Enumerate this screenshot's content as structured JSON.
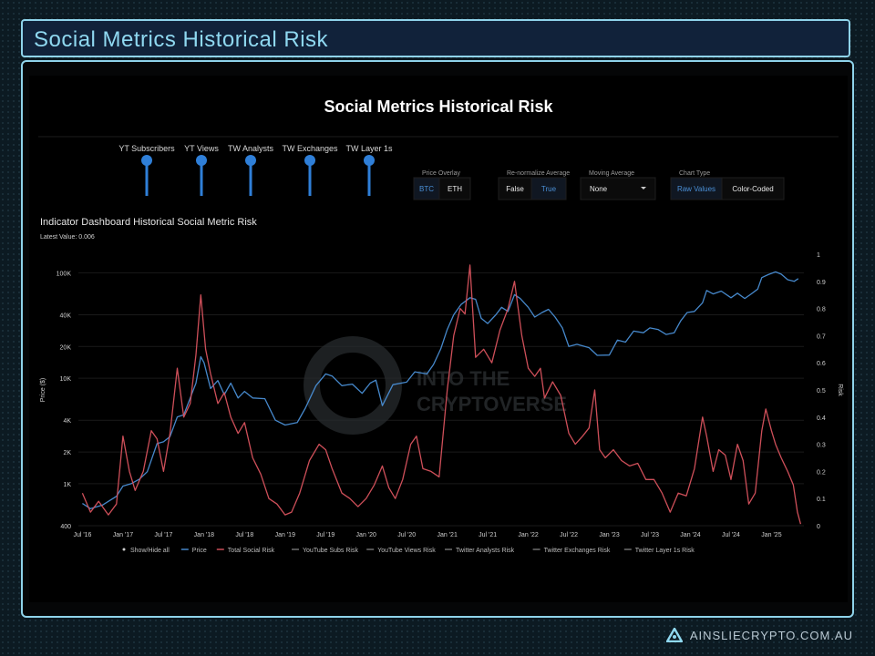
{
  "header": {
    "title": "Social Metrics Historical Risk"
  },
  "footer": {
    "site": "AINSLIECRYPTO.COM.AU"
  },
  "chart_data": {
    "type": "line",
    "title": "Social Metrics Historical Risk",
    "subtitle": "Indicator Dashboard Historical Social Metric Risk",
    "latest_value": "Latest Value: 0.006",
    "y_label_left": "Price ($)",
    "y_label_right": "Risk",
    "watermark": [
      "INTO THE",
      "CRYPTOVERSE"
    ],
    "sliders": [
      "YT Subscribers",
      "YT Views",
      "TW Analysts",
      "TW Exchanges",
      "TW Layer 1s"
    ],
    "controls": [
      {
        "label": "Price Overlay",
        "options": [
          "BTC",
          "ETH"
        ],
        "active": 0
      },
      {
        "label": "Re-normalize Average",
        "options": [
          "False",
          "True"
        ],
        "active": 1
      },
      {
        "label": "Moving Average",
        "options": [
          "None"
        ],
        "active": 0,
        "dropdown": true
      },
      {
        "label": "Chart Type",
        "options": [
          "Raw Values",
          "Color-Coded"
        ],
        "active": 0
      }
    ],
    "legend": [
      "Show/Hide all",
      "Price",
      "Total Social Risk",
      "YouTube Subs Risk",
      "YouTube Views Risk",
      "Twitter Analysts Risk",
      "Twitter Exchanges Risk",
      "Twitter Layer 1s Risk"
    ],
    "x_ticks": [
      "Jul '16",
      "Jan '17",
      "Jul '17",
      "Jan '18",
      "Jul '18",
      "Jan '19",
      "Jul '19",
      "Jan '20",
      "Jul '20",
      "Jan '21",
      "Jul '21",
      "Jan '22",
      "Jul '22",
      "Jan '23",
      "Jul '23",
      "Jan '24",
      "Jul '24",
      "Jan '25"
    ],
    "xlim": [
      2016.45,
      2025.4
    ],
    "y_left_ticks": [
      {
        "v": 400,
        "l": "400"
      },
      {
        "v": 1000,
        "l": "1K"
      },
      {
        "v": 2000,
        "l": "2K"
      },
      {
        "v": 4000,
        "l": "4K"
      },
      {
        "v": 10000,
        "l": "10K"
      },
      {
        "v": 20000,
        "l": "20K"
      },
      {
        "v": 40000,
        "l": "40K"
      },
      {
        "v": 100000,
        "l": "100K"
      }
    ],
    "y_left_scale": "log",
    "y_left_range": [
      400,
      150000
    ],
    "y_right_ticks": [
      0,
      0.1,
      0.2,
      0.3,
      0.4,
      0.5,
      0.6,
      0.7,
      0.8,
      0.9,
      1
    ],
    "y_right_range": [
      0,
      1
    ],
    "series": [
      {
        "name": "Price",
        "color": "#4a8fd6",
        "axis": "left",
        "points": [
          [
            2016.5,
            650
          ],
          [
            2016.6,
            580
          ],
          [
            2016.75,
            630
          ],
          [
            2016.92,
            760
          ],
          [
            2017.0,
            950
          ],
          [
            2017.1,
            1000
          ],
          [
            2017.2,
            1100
          ],
          [
            2017.3,
            1300
          ],
          [
            2017.42,
            2400
          ],
          [
            2017.5,
            2500
          ],
          [
            2017.58,
            2800
          ],
          [
            2017.67,
            4300
          ],
          [
            2017.75,
            4500
          ],
          [
            2017.83,
            6500
          ],
          [
            2017.9,
            9000
          ],
          [
            2017.96,
            16000
          ],
          [
            2018.0,
            14000
          ],
          [
            2018.08,
            8000
          ],
          [
            2018.17,
            9500
          ],
          [
            2018.25,
            7000
          ],
          [
            2018.33,
            9000
          ],
          [
            2018.42,
            6500
          ],
          [
            2018.5,
            7500
          ],
          [
            2018.6,
            6500
          ],
          [
            2018.75,
            6400
          ],
          [
            2018.88,
            4000
          ],
          [
            2019.0,
            3600
          ],
          [
            2019.15,
            3800
          ],
          [
            2019.25,
            5200
          ],
          [
            2019.38,
            8500
          ],
          [
            2019.5,
            11000
          ],
          [
            2019.58,
            10500
          ],
          [
            2019.7,
            8500
          ],
          [
            2019.83,
            8800
          ],
          [
            2019.95,
            7200
          ],
          [
            2020.05,
            9000
          ],
          [
            2020.12,
            9600
          ],
          [
            2020.2,
            5500
          ],
          [
            2020.33,
            8700
          ],
          [
            2020.5,
            9200
          ],
          [
            2020.6,
            11500
          ],
          [
            2020.75,
            11000
          ],
          [
            2020.83,
            13500
          ],
          [
            2020.92,
            19000
          ],
          [
            2021.0,
            29000
          ],
          [
            2021.08,
            40000
          ],
          [
            2021.17,
            50000
          ],
          [
            2021.28,
            58000
          ],
          [
            2021.35,
            56000
          ],
          [
            2021.42,
            37000
          ],
          [
            2021.5,
            33000
          ],
          [
            2021.6,
            40000
          ],
          [
            2021.67,
            47000
          ],
          [
            2021.75,
            43000
          ],
          [
            2021.83,
            62000
          ],
          [
            2021.9,
            57000
          ],
          [
            2022.0,
            47000
          ],
          [
            2022.08,
            38000
          ],
          [
            2022.17,
            42000
          ],
          [
            2022.25,
            45000
          ],
          [
            2022.33,
            38000
          ],
          [
            2022.42,
            30000
          ],
          [
            2022.5,
            20000
          ],
          [
            2022.6,
            21000
          ],
          [
            2022.75,
            19500
          ],
          [
            2022.85,
            16500
          ],
          [
            2023.0,
            16600
          ],
          [
            2023.1,
            23000
          ],
          [
            2023.2,
            22000
          ],
          [
            2023.3,
            28000
          ],
          [
            2023.42,
            27000
          ],
          [
            2023.5,
            30000
          ],
          [
            2023.6,
            29000
          ],
          [
            2023.7,
            26000
          ],
          [
            2023.8,
            27000
          ],
          [
            2023.88,
            35000
          ],
          [
            2023.96,
            42000
          ],
          [
            2024.05,
            43000
          ],
          [
            2024.15,
            52000
          ],
          [
            2024.2,
            68000
          ],
          [
            2024.28,
            63000
          ],
          [
            2024.38,
            67000
          ],
          [
            2024.5,
            58000
          ],
          [
            2024.58,
            64000
          ],
          [
            2024.67,
            57000
          ],
          [
            2024.75,
            63000
          ],
          [
            2024.83,
            70000
          ],
          [
            2024.88,
            90000
          ],
          [
            2024.96,
            96000
          ],
          [
            2025.05,
            102000
          ],
          [
            2025.12,
            97000
          ],
          [
            2025.2,
            86000
          ],
          [
            2025.28,
            83000
          ],
          [
            2025.33,
            88000
          ]
        ]
      },
      {
        "name": "Total Social Risk",
        "color": "#d9535e",
        "axis": "right",
        "points": [
          [
            2016.5,
            0.12
          ],
          [
            2016.6,
            0.05
          ],
          [
            2016.7,
            0.09
          ],
          [
            2016.82,
            0.04
          ],
          [
            2016.92,
            0.08
          ],
          [
            2017.0,
            0.33
          ],
          [
            2017.08,
            0.2
          ],
          [
            2017.15,
            0.13
          ],
          [
            2017.25,
            0.2
          ],
          [
            2017.35,
            0.35
          ],
          [
            2017.42,
            0.32
          ],
          [
            2017.5,
            0.2
          ],
          [
            2017.58,
            0.34
          ],
          [
            2017.67,
            0.58
          ],
          [
            2017.75,
            0.4
          ],
          [
            2017.83,
            0.45
          ],
          [
            2017.9,
            0.63
          ],
          [
            2017.96,
            0.85
          ],
          [
            2018.02,
            0.65
          ],
          [
            2018.08,
            0.56
          ],
          [
            2018.17,
            0.45
          ],
          [
            2018.25,
            0.49
          ],
          [
            2018.33,
            0.4
          ],
          [
            2018.42,
            0.34
          ],
          [
            2018.5,
            0.38
          ],
          [
            2018.6,
            0.25
          ],
          [
            2018.7,
            0.19
          ],
          [
            2018.8,
            0.1
          ],
          [
            2018.9,
            0.08
          ],
          [
            2019.0,
            0.04
          ],
          [
            2019.08,
            0.05
          ],
          [
            2019.18,
            0.12
          ],
          [
            2019.3,
            0.24
          ],
          [
            2019.42,
            0.3
          ],
          [
            2019.5,
            0.28
          ],
          [
            2019.58,
            0.21
          ],
          [
            2019.7,
            0.12
          ],
          [
            2019.8,
            0.1
          ],
          [
            2019.9,
            0.07
          ],
          [
            2020.0,
            0.1
          ],
          [
            2020.1,
            0.15
          ],
          [
            2020.2,
            0.22
          ],
          [
            2020.28,
            0.14
          ],
          [
            2020.36,
            0.1
          ],
          [
            2020.45,
            0.17
          ],
          [
            2020.55,
            0.3
          ],
          [
            2020.62,
            0.33
          ],
          [
            2020.7,
            0.21
          ],
          [
            2020.8,
            0.2
          ],
          [
            2020.9,
            0.18
          ],
          [
            2021.0,
            0.5
          ],
          [
            2021.08,
            0.7
          ],
          [
            2021.16,
            0.8
          ],
          [
            2021.22,
            0.78
          ],
          [
            2021.28,
            0.96
          ],
          [
            2021.35,
            0.62
          ],
          [
            2021.45,
            0.65
          ],
          [
            2021.55,
            0.6
          ],
          [
            2021.65,
            0.72
          ],
          [
            2021.75,
            0.8
          ],
          [
            2021.83,
            0.9
          ],
          [
            2021.92,
            0.7
          ],
          [
            2022.0,
            0.58
          ],
          [
            2022.08,
            0.55
          ],
          [
            2022.15,
            0.58
          ],
          [
            2022.2,
            0.47
          ],
          [
            2022.3,
            0.53
          ],
          [
            2022.4,
            0.48
          ],
          [
            2022.5,
            0.34
          ],
          [
            2022.58,
            0.3
          ],
          [
            2022.67,
            0.33
          ],
          [
            2022.75,
            0.36
          ],
          [
            2022.82,
            0.5
          ],
          [
            2022.88,
            0.28
          ],
          [
            2022.95,
            0.25
          ],
          [
            2023.05,
            0.28
          ],
          [
            2023.15,
            0.24
          ],
          [
            2023.25,
            0.22
          ],
          [
            2023.35,
            0.23
          ],
          [
            2023.45,
            0.17
          ],
          [
            2023.55,
            0.17
          ],
          [
            2023.65,
            0.12
          ],
          [
            2023.75,
            0.05
          ],
          [
            2023.85,
            0.12
          ],
          [
            2023.95,
            0.11
          ],
          [
            2024.05,
            0.21
          ],
          [
            2024.15,
            0.4
          ],
          [
            2024.2,
            0.33
          ],
          [
            2024.28,
            0.2
          ],
          [
            2024.35,
            0.28
          ],
          [
            2024.43,
            0.26
          ],
          [
            2024.5,
            0.17
          ],
          [
            2024.58,
            0.3
          ],
          [
            2024.65,
            0.24
          ],
          [
            2024.72,
            0.08
          ],
          [
            2024.8,
            0.12
          ],
          [
            2024.88,
            0.35
          ],
          [
            2024.93,
            0.43
          ],
          [
            2025.0,
            0.35
          ],
          [
            2025.05,
            0.3
          ],
          [
            2025.12,
            0.25
          ],
          [
            2025.2,
            0.2
          ],
          [
            2025.27,
            0.15
          ],
          [
            2025.32,
            0.05
          ],
          [
            2025.36,
            0.006
          ]
        ]
      }
    ]
  }
}
